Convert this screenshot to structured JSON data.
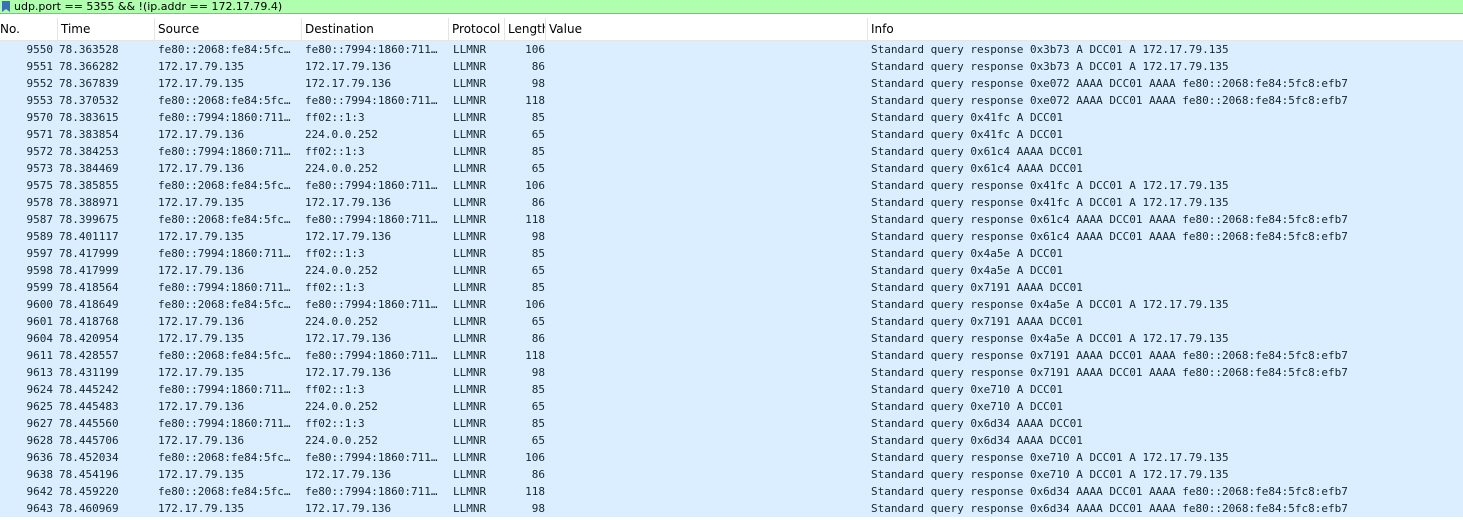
{
  "filter": {
    "text": "udp.port == 5355 && !(ip.addr == 172.17.79.4)"
  },
  "columns": [
    "No.",
    "Time",
    "Source",
    "Destination",
    "Protocol",
    "Length",
    "Value",
    "Info"
  ],
  "rows": [
    {
      "no": "9550",
      "time": "78.363528",
      "source": "fe80::2068:fe84:5fc…",
      "destination": "fe80::7994:1860:711…",
      "protocol": "LLMNR",
      "length": "106",
      "value": "",
      "info": "Standard query response 0x3b73 A DCC01 A 172.17.79.135"
    },
    {
      "no": "9551",
      "time": "78.366282",
      "source": "172.17.79.135",
      "destination": "172.17.79.136",
      "protocol": "LLMNR",
      "length": "86",
      "value": "",
      "info": "Standard query response 0x3b73 A DCC01 A 172.17.79.135"
    },
    {
      "no": "9552",
      "time": "78.367839",
      "source": "172.17.79.135",
      "destination": "172.17.79.136",
      "protocol": "LLMNR",
      "length": "98",
      "value": "",
      "info": "Standard query response 0xe072 AAAA DCC01 AAAA fe80::2068:fe84:5fc8:efb7"
    },
    {
      "no": "9553",
      "time": "78.370532",
      "source": "fe80::2068:fe84:5fc…",
      "destination": "fe80::7994:1860:711…",
      "protocol": "LLMNR",
      "length": "118",
      "value": "",
      "info": "Standard query response 0xe072 AAAA DCC01 AAAA fe80::2068:fe84:5fc8:efb7"
    },
    {
      "no": "9570",
      "time": "78.383615",
      "source": "fe80::7994:1860:711…",
      "destination": "ff02::1:3",
      "protocol": "LLMNR",
      "length": "85",
      "value": "",
      "info": "Standard query 0x41fc A DCC01"
    },
    {
      "no": "9571",
      "time": "78.383854",
      "source": "172.17.79.136",
      "destination": "224.0.0.252",
      "protocol": "LLMNR",
      "length": "65",
      "value": "",
      "info": "Standard query 0x41fc A DCC01"
    },
    {
      "no": "9572",
      "time": "78.384253",
      "source": "fe80::7994:1860:711…",
      "destination": "ff02::1:3",
      "protocol": "LLMNR",
      "length": "85",
      "value": "",
      "info": "Standard query 0x61c4 AAAA DCC01"
    },
    {
      "no": "9573",
      "time": "78.384469",
      "source": "172.17.79.136",
      "destination": "224.0.0.252",
      "protocol": "LLMNR",
      "length": "65",
      "value": "",
      "info": "Standard query 0x61c4 AAAA DCC01"
    },
    {
      "no": "9575",
      "time": "78.385855",
      "source": "fe80::2068:fe84:5fc…",
      "destination": "fe80::7994:1860:711…",
      "protocol": "LLMNR",
      "length": "106",
      "value": "",
      "info": "Standard query response 0x41fc A DCC01 A 172.17.79.135"
    },
    {
      "no": "9578",
      "time": "78.388971",
      "source": "172.17.79.135",
      "destination": "172.17.79.136",
      "protocol": "LLMNR",
      "length": "86",
      "value": "",
      "info": "Standard query response 0x41fc A DCC01 A 172.17.79.135"
    },
    {
      "no": "9587",
      "time": "78.399675",
      "source": "fe80::2068:fe84:5fc…",
      "destination": "fe80::7994:1860:711…",
      "protocol": "LLMNR",
      "length": "118",
      "value": "",
      "info": "Standard query response 0x61c4 AAAA DCC01 AAAA fe80::2068:fe84:5fc8:efb7"
    },
    {
      "no": "9589",
      "time": "78.401117",
      "source": "172.17.79.135",
      "destination": "172.17.79.136",
      "protocol": "LLMNR",
      "length": "98",
      "value": "",
      "info": "Standard query response 0x61c4 AAAA DCC01 AAAA fe80::2068:fe84:5fc8:efb7"
    },
    {
      "no": "9597",
      "time": "78.417999",
      "source": "fe80::7994:1860:711…",
      "destination": "ff02::1:3",
      "protocol": "LLMNR",
      "length": "85",
      "value": "",
      "info": "Standard query 0x4a5e A DCC01"
    },
    {
      "no": "9598",
      "time": "78.417999",
      "source": "172.17.79.136",
      "destination": "224.0.0.252",
      "protocol": "LLMNR",
      "length": "65",
      "value": "",
      "info": "Standard query 0x4a5e A DCC01"
    },
    {
      "no": "9599",
      "time": "78.418564",
      "source": "fe80::7994:1860:711…",
      "destination": "ff02::1:3",
      "protocol": "LLMNR",
      "length": "85",
      "value": "",
      "info": "Standard query 0x7191 AAAA DCC01"
    },
    {
      "no": "9600",
      "time": "78.418649",
      "source": "fe80::2068:fe84:5fc…",
      "destination": "fe80::7994:1860:711…",
      "protocol": "LLMNR",
      "length": "106",
      "value": "",
      "info": "Standard query response 0x4a5e A DCC01 A 172.17.79.135"
    },
    {
      "no": "9601",
      "time": "78.418768",
      "source": "172.17.79.136",
      "destination": "224.0.0.252",
      "protocol": "LLMNR",
      "length": "65",
      "value": "",
      "info": "Standard query 0x7191 AAAA DCC01"
    },
    {
      "no": "9604",
      "time": "78.420954",
      "source": "172.17.79.135",
      "destination": "172.17.79.136",
      "protocol": "LLMNR",
      "length": "86",
      "value": "",
      "info": "Standard query response 0x4a5e A DCC01 A 172.17.79.135"
    },
    {
      "no": "9611",
      "time": "78.428557",
      "source": "fe80::2068:fe84:5fc…",
      "destination": "fe80::7994:1860:711…",
      "protocol": "LLMNR",
      "length": "118",
      "value": "",
      "info": "Standard query response 0x7191 AAAA DCC01 AAAA fe80::2068:fe84:5fc8:efb7"
    },
    {
      "no": "9613",
      "time": "78.431199",
      "source": "172.17.79.135",
      "destination": "172.17.79.136",
      "protocol": "LLMNR",
      "length": "98",
      "value": "",
      "info": "Standard query response 0x7191 AAAA DCC01 AAAA fe80::2068:fe84:5fc8:efb7"
    },
    {
      "no": "9624",
      "time": "78.445242",
      "source": "fe80::7994:1860:711…",
      "destination": "ff02::1:3",
      "protocol": "LLMNR",
      "length": "85",
      "value": "",
      "info": "Standard query 0xe710 A DCC01"
    },
    {
      "no": "9625",
      "time": "78.445483",
      "source": "172.17.79.136",
      "destination": "224.0.0.252",
      "protocol": "LLMNR",
      "length": "65",
      "value": "",
      "info": "Standard query 0xe710 A DCC01"
    },
    {
      "no": "9627",
      "time": "78.445560",
      "source": "fe80::7994:1860:711…",
      "destination": "ff02::1:3",
      "protocol": "LLMNR",
      "length": "85",
      "value": "",
      "info": "Standard query 0x6d34 AAAA DCC01"
    },
    {
      "no": "9628",
      "time": "78.445706",
      "source": "172.17.79.136",
      "destination": "224.0.0.252",
      "protocol": "LLMNR",
      "length": "65",
      "value": "",
      "info": "Standard query 0x6d34 AAAA DCC01"
    },
    {
      "no": "9636",
      "time": "78.452034",
      "source": "fe80::2068:fe84:5fc…",
      "destination": "fe80::7994:1860:711…",
      "protocol": "LLMNR",
      "length": "106",
      "value": "",
      "info": "Standard query response 0xe710 A DCC01 A 172.17.79.135"
    },
    {
      "no": "9638",
      "time": "78.454196",
      "source": "172.17.79.135",
      "destination": "172.17.79.136",
      "protocol": "LLMNR",
      "length": "86",
      "value": "",
      "info": "Standard query response 0xe710 A DCC01 A 172.17.79.135"
    },
    {
      "no": "9642",
      "time": "78.459220",
      "source": "fe80::2068:fe84:5fc…",
      "destination": "fe80::7994:1860:711…",
      "protocol": "LLMNR",
      "length": "118",
      "value": "",
      "info": "Standard query response 0x6d34 AAAA DCC01 AAAA fe80::2068:fe84:5fc8:efb7"
    },
    {
      "no": "9643",
      "time": "78.460969",
      "source": "172.17.79.135",
      "destination": "172.17.79.136",
      "protocol": "LLMNR",
      "length": "98",
      "value": "",
      "info": "Standard query response 0x6d34 AAAA DCC01 AAAA fe80::2068:fe84:5fc8:efb7"
    }
  ]
}
